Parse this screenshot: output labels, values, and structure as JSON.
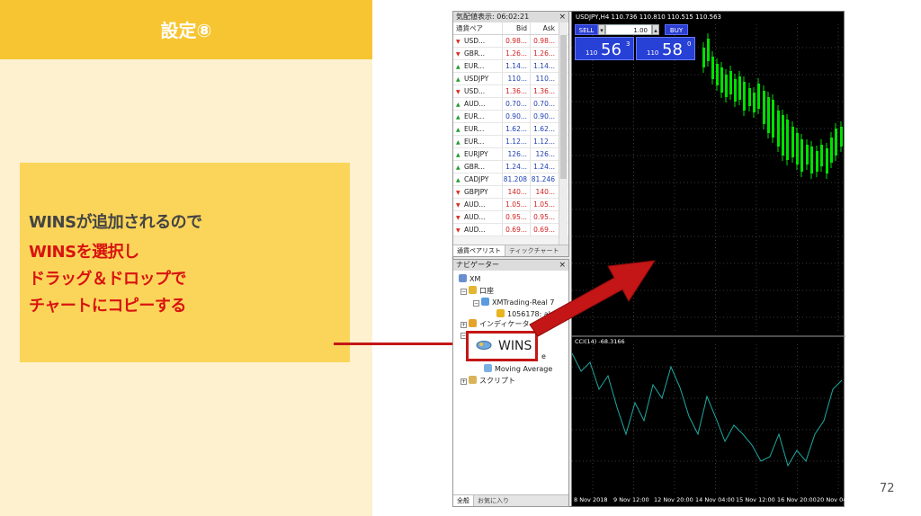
{
  "slide": {
    "title": "設定⑧",
    "callout_line1": "WINSが追加されるので",
    "callout_red_lines": [
      "WINSを選択し",
      "ドラッグ＆ドロップで",
      "チャートにコピーする"
    ],
    "page_number": "72",
    "colors": {
      "header": "#f7c531",
      "panel": "#fdf1cf",
      "callout": "#fbd55a",
      "emphasis": "#d8130f",
      "arrow": "#c41616"
    }
  },
  "market_watch": {
    "title": "気配値表示: 06:02:21",
    "columns": [
      "通貨ペア",
      "Bid",
      "Ask"
    ],
    "rows": [
      {
        "symbol": "USD...",
        "bid": "0.98...",
        "ask": "0.98...",
        "dir": "down",
        "color": "red"
      },
      {
        "symbol": "GBR...",
        "bid": "1.26...",
        "ask": "1.26...",
        "dir": "down",
        "color": "red"
      },
      {
        "symbol": "EUR...",
        "bid": "1.14...",
        "ask": "1.14...",
        "dir": "up",
        "color": "blue"
      },
      {
        "symbol": "USDJPY",
        "bid": "110...",
        "ask": "110...",
        "dir": "up",
        "color": "blue"
      },
      {
        "symbol": "USD...",
        "bid": "1.36...",
        "ask": "1.36...",
        "dir": "down",
        "color": "red"
      },
      {
        "symbol": "AUD...",
        "bid": "0.70...",
        "ask": "0.70...",
        "dir": "up",
        "color": "blue"
      },
      {
        "symbol": "EUR...",
        "bid": "0.90...",
        "ask": "0.90...",
        "dir": "up",
        "color": "blue"
      },
      {
        "symbol": "EUR...",
        "bid": "1.62...",
        "ask": "1.62...",
        "dir": "up",
        "color": "blue"
      },
      {
        "symbol": "EUR...",
        "bid": "1.12...",
        "ask": "1.12...",
        "dir": "up",
        "color": "blue"
      },
      {
        "symbol": "EURJPY",
        "bid": "126...",
        "ask": "126...",
        "dir": "up",
        "color": "blue"
      },
      {
        "symbol": "GBR...",
        "bid": "1.24...",
        "ask": "1.24...",
        "dir": "up",
        "color": "blue"
      },
      {
        "symbol": "CADJPY",
        "bid": "81.208",
        "ask": "81.246",
        "dir": "up",
        "color": "blue"
      },
      {
        "symbol": "GBPJPY",
        "bid": "140...",
        "ask": "140...",
        "dir": "down",
        "color": "red"
      },
      {
        "symbol": "AUD...",
        "bid": "1.05...",
        "ask": "1.05...",
        "dir": "down",
        "color": "red"
      },
      {
        "symbol": "AUD...",
        "bid": "0.95...",
        "ask": "0.95...",
        "dir": "down",
        "color": "red"
      },
      {
        "symbol": "AUD...",
        "bid": "0.69...",
        "ask": "0.69...",
        "dir": "down",
        "color": "red"
      }
    ],
    "tabs": [
      "通貨ペアリスト",
      "ティックチャート"
    ]
  },
  "navigator": {
    "title": "ナビゲーター",
    "items": {
      "root": "XM",
      "accounts": "口座",
      "account_server": "XMTrading-Real 7",
      "account_number": "1056178: ab",
      "indicators": "インディケータ",
      "wins": "WINS",
      "ea_partial": "e",
      "moving_average": "Moving Average",
      "scripts": "スクリプト"
    },
    "tabs": [
      "全般",
      "お気に入り"
    ]
  },
  "chart": {
    "info": "USDJPY,H4  110.736 110.810 110.515 110.563",
    "sell_label": "SELL",
    "buy_label": "BUY",
    "lot": "1.00",
    "sell_price": {
      "prefix": "110",
      "big": "56",
      "sup": "3"
    },
    "buy_price": {
      "prefix": "110",
      "big": "58",
      "sup": "0"
    },
    "cci_label": "CCI(14) -68.3166",
    "dates": [
      "8 Nov 2018",
      "9 Nov 12:00",
      "12 Nov 20:00",
      "14 Nov 04:00",
      "15 Nov 12:00",
      "16 Nov 20:00",
      "20 Nov 04"
    ],
    "colors": {
      "up_candle": "#00e000",
      "cci_line": "#1fa9a0",
      "grid": "#3a3a3a"
    }
  }
}
